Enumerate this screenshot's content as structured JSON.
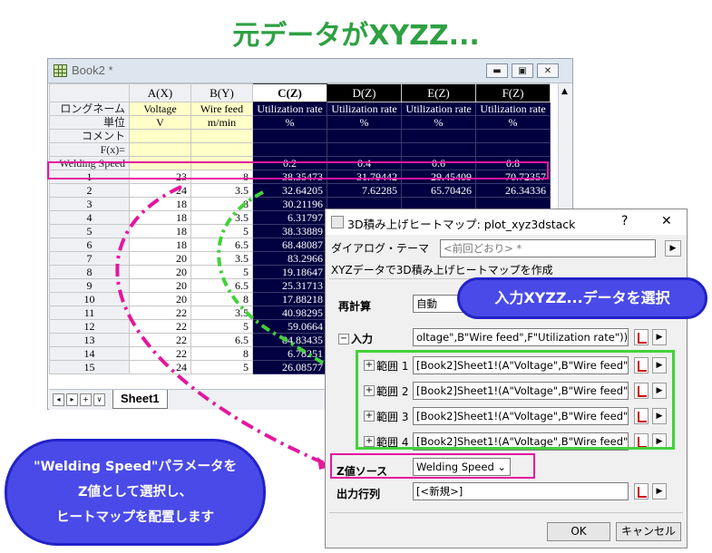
{
  "headline": "元データがXYZZ...",
  "book": {
    "title": "Book2 *",
    "columns": [
      "A(X)",
      "B(Y)",
      "C(Z)",
      "D(Z)",
      "E(Z)",
      "F(Z)"
    ],
    "row_labels": {
      "longname": "ロングネーム",
      "units": "単位",
      "comment": "コメント",
      "fx": "F(x)=",
      "param": "Welding Speed"
    },
    "longnames": [
      "Voltage",
      "Wire feed",
      "Utilization rate",
      "Utilization rate",
      "Utilization rate",
      "Utilization rate"
    ],
    "units": [
      "V",
      "m/min",
      "%",
      "%",
      "%",
      "%"
    ],
    "param_values": [
      "",
      "",
      "0.2",
      "0.4",
      "0.6",
      "0.8"
    ],
    "rows": [
      [
        "1",
        "23",
        "8",
        "38.35473",
        "31.79442",
        "29.45409",
        "70.72357"
      ],
      [
        "2",
        "24",
        "3.5",
        "32.64205",
        "7.62285",
        "65.70426",
        "26.34336"
      ],
      [
        "3",
        "18",
        "8",
        "30.21196",
        "",
        "",
        ""
      ],
      [
        "4",
        "18",
        "3.5",
        "6.31797",
        "",
        "",
        ""
      ],
      [
        "5",
        "18",
        "5",
        "38.33889",
        "",
        "",
        ""
      ],
      [
        "6",
        "18",
        "6.5",
        "68.48087",
        "",
        "",
        ""
      ],
      [
        "7",
        "20",
        "3.5",
        "83.2966",
        "",
        "",
        ""
      ],
      [
        "8",
        "20",
        "5",
        "19.18647",
        "",
        "",
        ""
      ],
      [
        "9",
        "20",
        "6.5",
        "25.31713",
        "",
        "",
        ""
      ],
      [
        "10",
        "20",
        "8",
        "17.88218",
        "",
        "",
        ""
      ],
      [
        "11",
        "22",
        "3.5",
        "40.98295",
        "",
        "",
        ""
      ],
      [
        "12",
        "22",
        "5",
        "59.0664",
        "",
        "",
        ""
      ],
      [
        "13",
        "22",
        "6.5",
        "84.83435",
        "",
        "",
        ""
      ],
      [
        "14",
        "22",
        "8",
        "6.78251",
        "",
        "",
        ""
      ],
      [
        "15",
        "24",
        "5",
        "26.08577",
        "",
        "",
        ""
      ]
    ],
    "sheet_tab": "Sheet1",
    "nav": [
      "◂",
      "▸",
      "+",
      "∨"
    ]
  },
  "dialog": {
    "title": "3D積み上げヒートマップ: plot_xyz3dstack",
    "help": "?",
    "close": "✕",
    "theme_label": "ダイアログ・テーマ",
    "theme_value": "<前回どおり> *",
    "description": "XYZデータで3D積み上げヒートマップを作成",
    "recalc_label": "再計算",
    "recalc_value": "自動",
    "input_label": "入力",
    "input_value": "oltage\",B\"Wire feed\",F\"Utilization rate\"))",
    "ranges": [
      {
        "label": "範囲 1",
        "value": "[Book2]Sheet1!(A\"Voltage\",B\"Wire feed\""
      },
      {
        "label": "範囲 2",
        "value": "[Book2]Sheet1!(A\"Voltage\",B\"Wire feed\""
      },
      {
        "label": "範囲 3",
        "value": "[Book2]Sheet1!(A\"Voltage\",B\"Wire feed\""
      },
      {
        "label": "範囲 4",
        "value": "[Book2]Sheet1!(A\"Voltage\",B\"Wire feed\""
      }
    ],
    "zsource_label": "Z値ソース",
    "zsource_value": "Welding Speed",
    "output_label": "出力行列",
    "output_value": "[<新規>]",
    "ok": "OK",
    "cancel": "キャンセル"
  },
  "callouts": {
    "top": "入力XYZZ...データを選択",
    "bottom_lines": [
      "\"Welding Speed\"パラメータを",
      "Z値として選択し、",
      "ヒートマップを配置します"
    ]
  },
  "colors": {
    "headline": "#2ea043",
    "callout": "#4a4ae8",
    "pink": "#e5169e",
    "green": "#43d13b",
    "dark_col": "#000040"
  }
}
